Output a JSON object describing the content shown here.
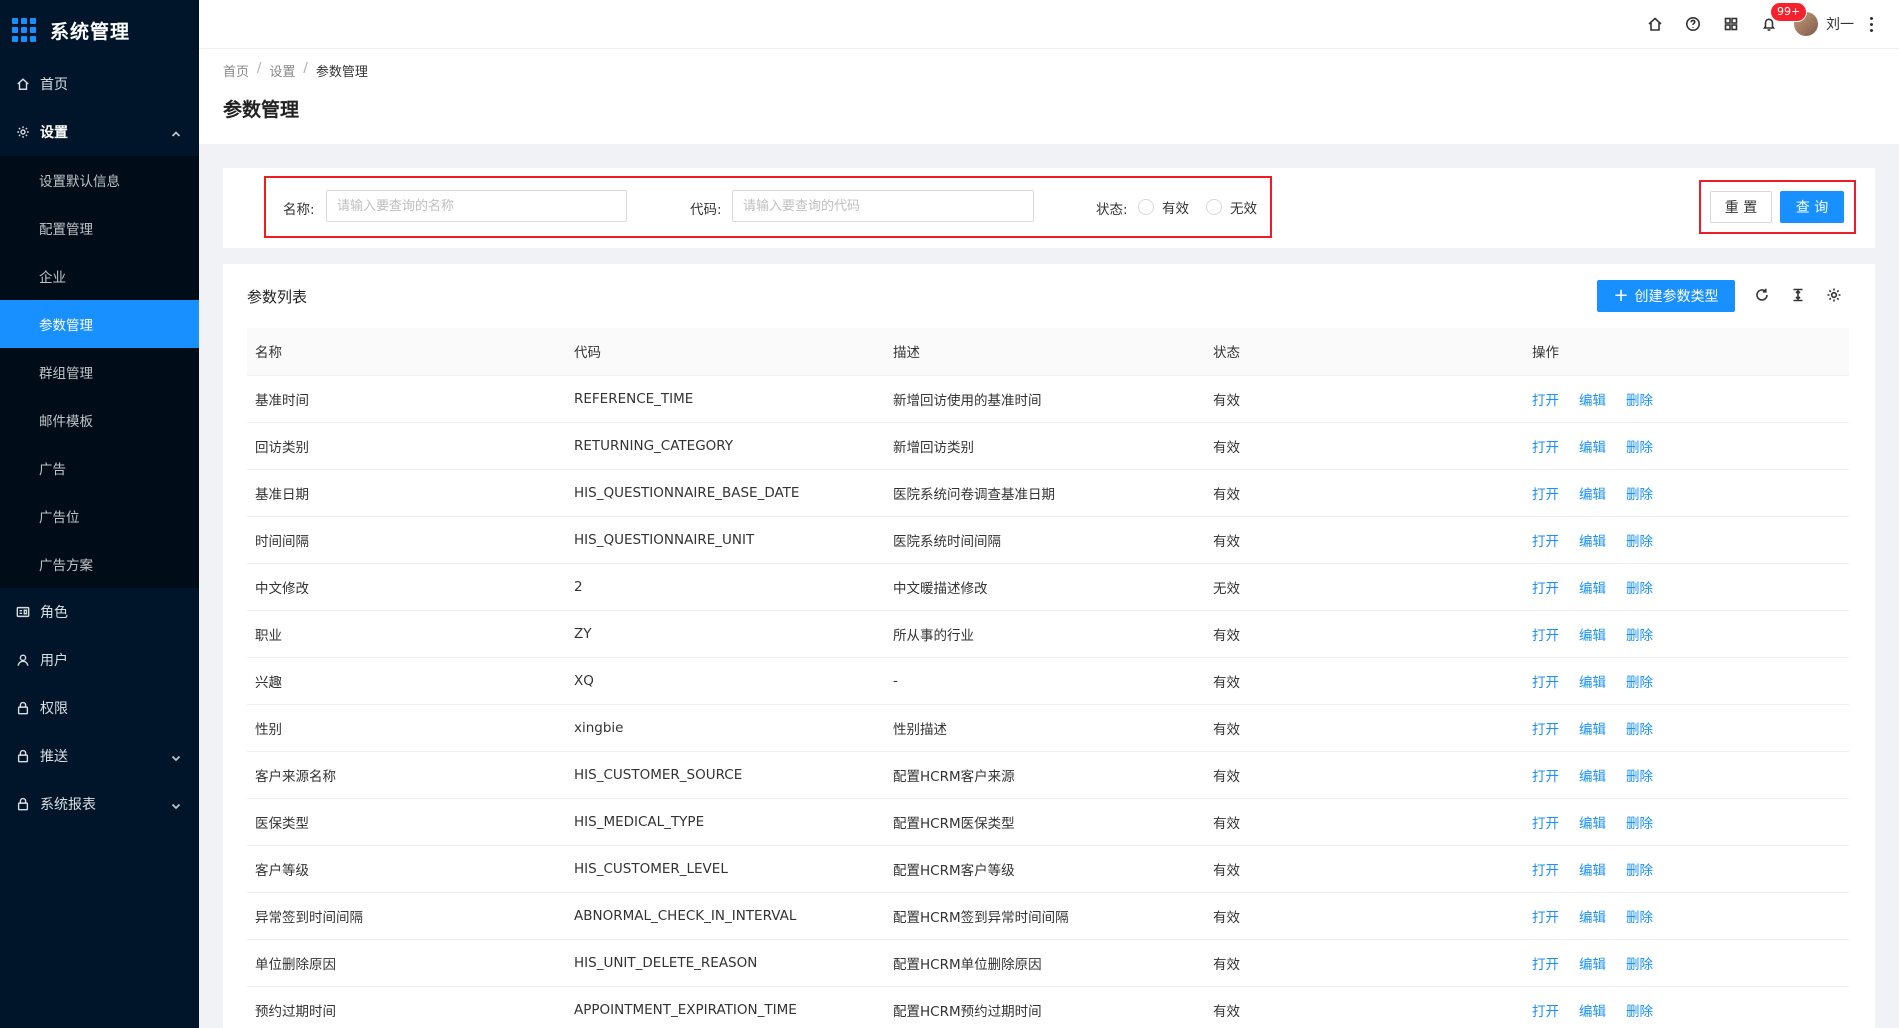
{
  "app": {
    "title": "系统管理"
  },
  "sidebar": {
    "items": [
      {
        "label": "首页",
        "icon": "home-icon"
      },
      {
        "label": "设置",
        "icon": "gear-icon",
        "open": true,
        "children": [
          {
            "label": "设置默认信息"
          },
          {
            "label": "配置管理"
          },
          {
            "label": "企业"
          },
          {
            "label": "参数管理",
            "active": true
          },
          {
            "label": "群组管理"
          },
          {
            "label": "邮件模板"
          },
          {
            "label": "广告"
          },
          {
            "label": "广告位"
          },
          {
            "label": "广告方案"
          }
        ]
      },
      {
        "label": "角色",
        "icon": "id-card-icon"
      },
      {
        "label": "用户",
        "icon": "user-icon"
      },
      {
        "label": "权限",
        "icon": "lock-icon"
      },
      {
        "label": "推送",
        "icon": "lock-icon",
        "expandable": true
      },
      {
        "label": "系统报表",
        "icon": "lock-icon",
        "expandable": true
      }
    ]
  },
  "header": {
    "notification_count": "99+",
    "user_name": "刘一"
  },
  "breadcrumb": [
    "首页",
    "设置",
    "参数管理"
  ],
  "page_title": "参数管理",
  "search": {
    "name_label": "名称:",
    "name_placeholder": "请输入要查询的名称",
    "code_label": "代码:",
    "code_placeholder": "请输入要查询的代码",
    "status_label": "状态:",
    "status_options": [
      "有效",
      "无效"
    ],
    "reset_label": "重 置",
    "query_label": "查 询"
  },
  "table": {
    "title": "参数列表",
    "create_label": "创建参数类型",
    "columns": [
      "名称",
      "代码",
      "描述",
      "状态",
      "操作"
    ],
    "actions": [
      "打开",
      "编辑",
      "删除"
    ],
    "rows": [
      {
        "name": "基准时间",
        "code": "REFERENCE_TIME",
        "desc": "新增回访使用的基准时间",
        "status": "有效"
      },
      {
        "name": "回访类别",
        "code": "RETURNING_CATEGORY",
        "desc": "新增回访类别",
        "status": "有效"
      },
      {
        "name": "基准日期",
        "code": "HIS_QUESTIONNAIRE_BASE_DATE",
        "desc": "医院系统问卷调查基准日期",
        "status": "有效"
      },
      {
        "name": "时间间隔",
        "code": "HIS_QUESTIONNAIRE_UNIT",
        "desc": "医院系统时间间隔",
        "status": "有效"
      },
      {
        "name": "中文修改",
        "code": "2",
        "desc": "中文暖描述修改",
        "status": "无效"
      },
      {
        "name": "职业",
        "code": "ZY",
        "desc": "所从事的行业",
        "status": "有效"
      },
      {
        "name": "兴趣",
        "code": "XQ",
        "desc": "-",
        "status": "有效"
      },
      {
        "name": "性别",
        "code": "xingbie",
        "desc": "性别描述",
        "status": "有效"
      },
      {
        "name": "客户来源名称",
        "code": "HIS_CUSTOMER_SOURCE",
        "desc": "配置HCRM客户来源",
        "status": "有效"
      },
      {
        "name": "医保类型",
        "code": "HIS_MEDICAL_TYPE",
        "desc": "配置HCRM医保类型",
        "status": "有效"
      },
      {
        "name": "客户等级",
        "code": "HIS_CUSTOMER_LEVEL",
        "desc": "配置HCRM客户等级",
        "status": "有效"
      },
      {
        "name": "异常签到时间间隔",
        "code": "ABNORMAL_CHECK_IN_INTERVAL",
        "desc": "配置HCRM签到异常时间间隔",
        "status": "有效"
      },
      {
        "name": "单位删除原因",
        "code": "HIS_UNIT_DELETE_REASON",
        "desc": "配置HCRM单位删除原因",
        "status": "有效"
      },
      {
        "name": "预约过期时间",
        "code": "APPOINTMENT_EXPIRATION_TIME",
        "desc": "配置HCRM预约过期时间",
        "status": "有效"
      }
    ]
  },
  "colors": {
    "primary": "#1890ff",
    "sidebar_bg": "#001529",
    "highlight_frame": "#ee1d23"
  }
}
